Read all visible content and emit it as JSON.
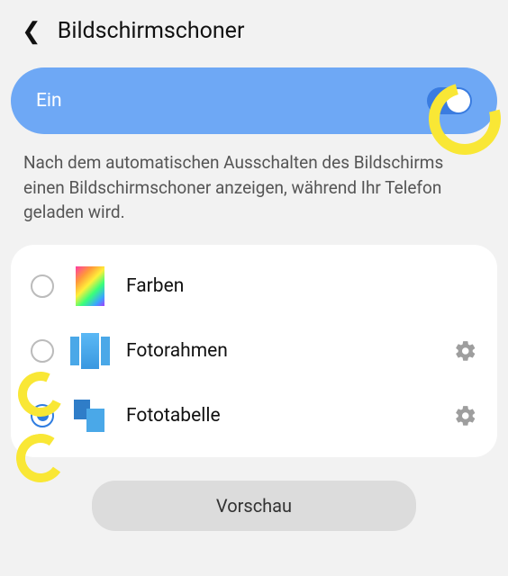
{
  "header": {
    "title": "Bildschirmschoner"
  },
  "toggle": {
    "label": "Ein",
    "state": "on"
  },
  "description": "Nach dem automatischen Ausschalten des Bildschirms einen Bildschirmschoner anzeigen, während Ihr Telefon geladen wird.",
  "options": [
    {
      "label": "Farben",
      "selected": false,
      "has_settings": false
    },
    {
      "label": "Fotorahmen",
      "selected": false,
      "has_settings": true
    },
    {
      "label": "Fototabelle",
      "selected": true,
      "has_settings": true
    }
  ],
  "preview_button": "Vorschau"
}
